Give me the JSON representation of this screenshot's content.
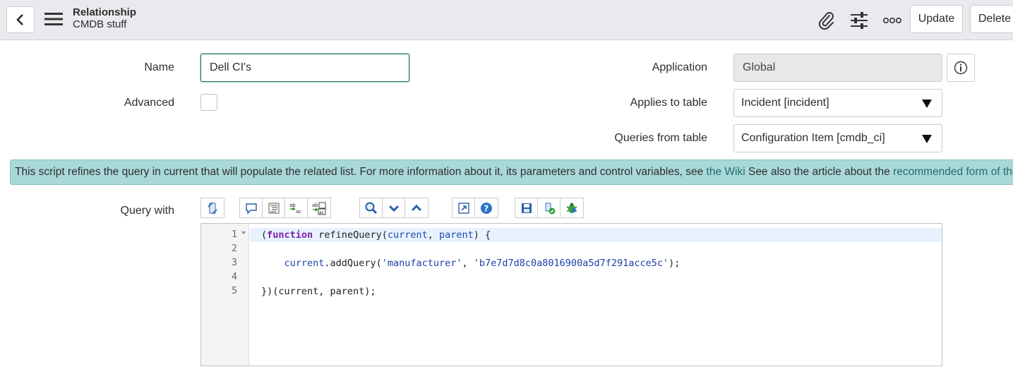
{
  "header": {
    "title": "Relationship",
    "subtitle": "CMDB stuff",
    "update_label": "Update",
    "delete_label": "Delete"
  },
  "form": {
    "name_label": "Name",
    "name_value": "Dell CI's",
    "advanced_label": "Advanced",
    "advanced_checked": false,
    "application_label": "Application",
    "application_value": "Global",
    "applies_to_label": "Applies to table",
    "applies_to_value": "Incident [incident]",
    "queries_from_label": "Queries from table",
    "queries_from_value": "Configuration Item [cmdb_ci]",
    "query_with_label": "Query with"
  },
  "banner": {
    "text_before": "This script refines the query in current that will populate the related list. For more information about it, its parameters and control variables, see ",
    "wiki_link": "the Wiki",
    "text_middle": " See also the article about the ",
    "article_link": "recommended form of the s"
  },
  "editor": {
    "line_numbers": [
      "1",
      "2",
      "3",
      "4",
      "5"
    ],
    "lines": [
      "(function refineQuery(current, parent) {",
      "",
      "    current.addQuery('manufacturer', 'b7e7d7d8c0a8016900a5d7f291acce5c');",
      "",
      "})(current, parent);"
    ]
  },
  "colors": {
    "banner_bg": "#a9d8d9",
    "link": "#1f6f6a",
    "focus_border": "#2e7a6e"
  }
}
